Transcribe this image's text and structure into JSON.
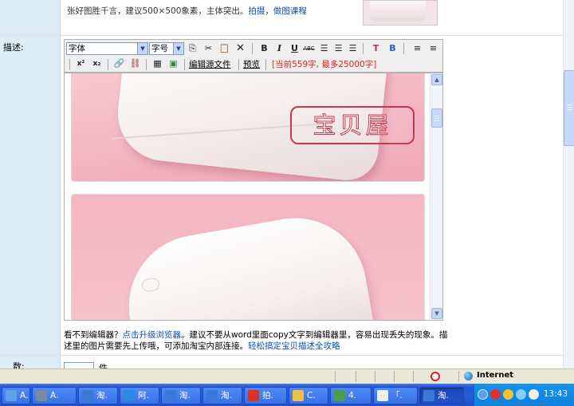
{
  "top_tip": {
    "text": "张好图胜千言，建议500×500象素，主体突出。",
    "link_shoot": "拍摄",
    "sep": "，",
    "link_course": "做图课程"
  },
  "field_labels": {
    "description": "描述:",
    "quantity": "数:"
  },
  "toolbar": {
    "font_select": "字体",
    "size_select": "字号",
    "edit_source": "编辑源文件",
    "preview": "预览",
    "char_count": "[当前559字, 最多25000字]",
    "bold": "B",
    "italic": "I",
    "underline": "U",
    "strike": "ABC",
    "superscript": "x²",
    "subscript": "x₂"
  },
  "editor": {
    "stamp_text": "宝贝屋",
    "scroll_up": "▲",
    "scroll_down": "▼"
  },
  "note": {
    "p1": "看不到编辑器？",
    "link_upgrade": "点击升级浏览器",
    "p2": "。建议不要从word里面copy文字到编辑器里，容易出现丢失的现象。描述里的图片需要先上传哦，可添加淘宝内部连接。",
    "link_guide": "轻松搞定宝贝描述全攻略"
  },
  "quantity": {
    "unit": "件"
  },
  "statusbar": {
    "zone": "Internet"
  },
  "taskbar": {
    "items": [
      {
        "label": "A.",
        "icon_color": "#5fa0e8"
      },
      {
        "label": "A.",
        "icon_color": "#7b8b9b"
      },
      {
        "label": "淘.",
        "icon_color": "#3a7ad6"
      },
      {
        "label": "阿.",
        "icon_color": "#2b8be0"
      },
      {
        "label": "淘.",
        "icon_color": "#3a7ad6"
      },
      {
        "label": "淘.",
        "icon_color": "#3a7ad6"
      },
      {
        "label": "拍.",
        "icon_color": "#e03020"
      },
      {
        "label": "C.",
        "icon_color": "#f0c040"
      },
      {
        "label": "4.",
        "icon_color": "#4aa040"
      },
      {
        "label": "「.",
        "icon_color": "#f0f0f0"
      },
      {
        "label": "淘.",
        "icon_color": "#3a7ad6"
      }
    ],
    "clock": "13:43"
  }
}
